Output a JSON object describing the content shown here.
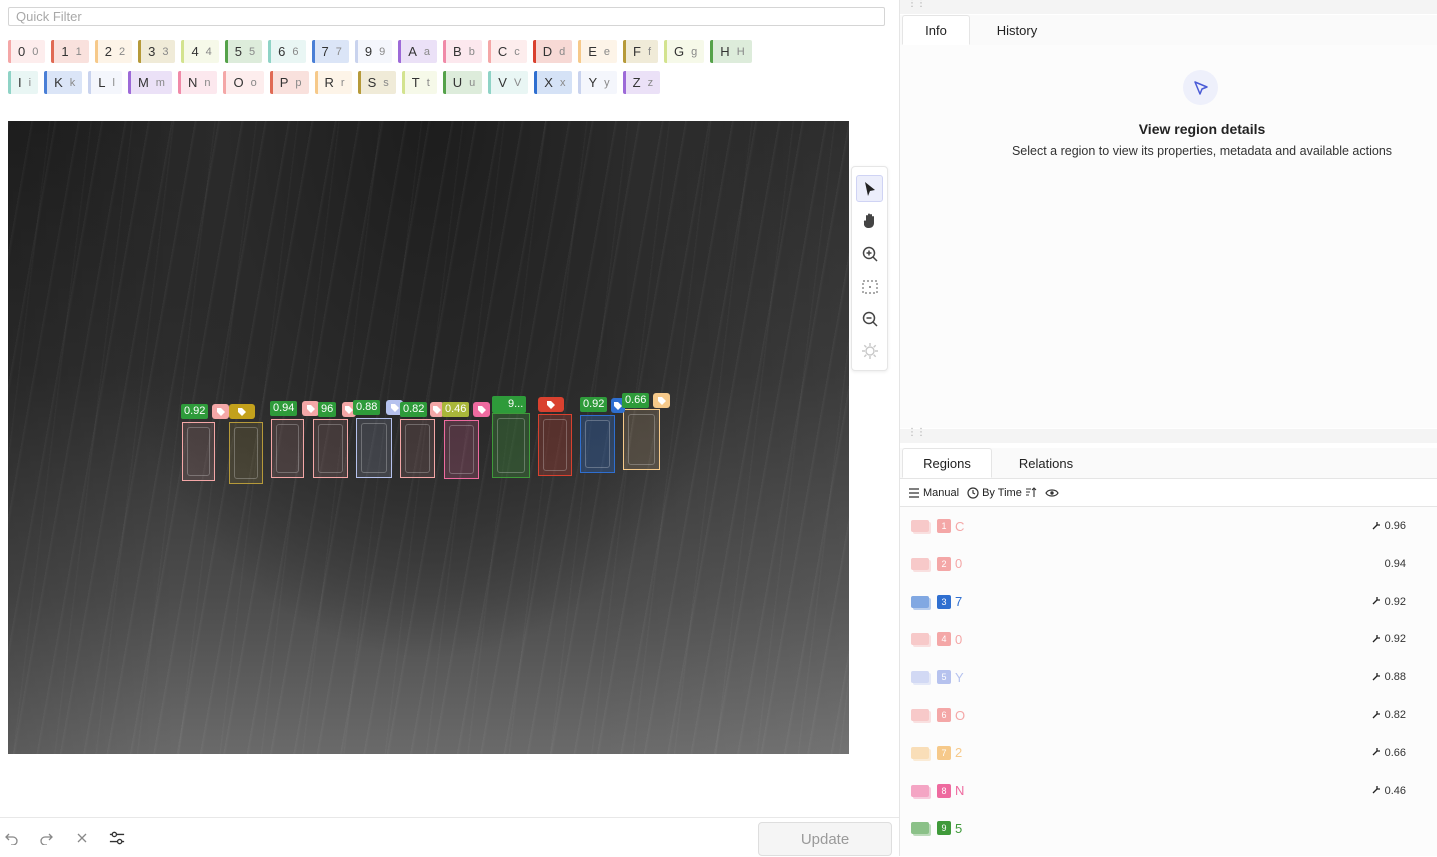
{
  "quick_filter": {
    "placeholder": "Quick Filter"
  },
  "labels_row1": [
    {
      "name": "0",
      "hotkey": "0",
      "color": "#f4a7a7"
    },
    {
      "name": "1",
      "hotkey": "1",
      "color": "#e06a54"
    },
    {
      "name": "2",
      "hotkey": "2",
      "color": "#f6c98a"
    },
    {
      "name": "3",
      "hotkey": "3",
      "color": "#b69a3a"
    },
    {
      "name": "4",
      "hotkey": "4",
      "color": "#d3e38f"
    },
    {
      "name": "5",
      "hotkey": "5",
      "color": "#55a24a"
    },
    {
      "name": "6",
      "hotkey": "6",
      "color": "#8fd3c6"
    },
    {
      "name": "7",
      "hotkey": "7",
      "color": "#4a7fd6"
    },
    {
      "name": "9",
      "hotkey": "9",
      "color": "#c9d3ee"
    },
    {
      "name": "A",
      "hotkey": "a",
      "color": "#9d6ad8"
    },
    {
      "name": "B",
      "hotkey": "b",
      "color": "#f08aa8"
    },
    {
      "name": "C",
      "hotkey": "c",
      "color": "#f4a7a7"
    },
    {
      "name": "D",
      "hotkey": "d",
      "color": "#d9412f"
    },
    {
      "name": "E",
      "hotkey": "e",
      "color": "#f6c98a"
    },
    {
      "name": "F",
      "hotkey": "f",
      "color": "#b69a3a"
    },
    {
      "name": "G",
      "hotkey": "g",
      "color": "#d3e38f"
    },
    {
      "name": "H",
      "hotkey": "H",
      "color": "#55a24a"
    }
  ],
  "labels_row2": [
    {
      "name": "I",
      "hotkey": "i",
      "color": "#8fd3c6"
    },
    {
      "name": "K",
      "hotkey": "k",
      "color": "#4a7fd6"
    },
    {
      "name": "L",
      "hotkey": "l",
      "color": "#c9d3ee"
    },
    {
      "name": "M",
      "hotkey": "m",
      "color": "#9d6ad8"
    },
    {
      "name": "N",
      "hotkey": "n",
      "color": "#f08aa8"
    },
    {
      "name": "O",
      "hotkey": "o",
      "color": "#f4a7a7"
    },
    {
      "name": "P",
      "hotkey": "p",
      "color": "#e06a54"
    },
    {
      "name": "R",
      "hotkey": "r",
      "color": "#f6c98a"
    },
    {
      "name": "S",
      "hotkey": "s",
      "color": "#b69a3a"
    },
    {
      "name": "T",
      "hotkey": "t",
      "color": "#d3e38f"
    },
    {
      "name": "U",
      "hotkey": "u",
      "color": "#55a24a"
    },
    {
      "name": "V",
      "hotkey": "V",
      "color": "#8fd3c6"
    },
    {
      "name": "X",
      "hotkey": "x",
      "color": "#2f6fd0"
    },
    {
      "name": "Y",
      "hotkey": "y",
      "color": "#c9d3ee"
    },
    {
      "name": "Z",
      "hotkey": "z",
      "color": "#9d6ad8"
    }
  ],
  "canvas_labels": [
    {
      "text": "0.92",
      "color": "#2e9b3a"
    },
    {
      "text": "0.94",
      "color": "#2e9b3a"
    },
    {
      "text": "96",
      "color": "#2e9b3a"
    },
    {
      "text": "0.88",
      "color": "#2e9b3a"
    },
    {
      "text": "0.82",
      "color": "#2e9b3a"
    },
    {
      "text": "0.46",
      "color": "#a9b73a"
    },
    {
      "text": "9...",
      "color": "#2e9b3a"
    },
    {
      "text": "0.92",
      "color": "#2e9b3a"
    },
    {
      "text": "0.66",
      "color": "#2e9b3a"
    }
  ],
  "right_panel": {
    "tabs_top": [
      {
        "label": "Info"
      },
      {
        "label": "History"
      }
    ],
    "info_title": "View region details",
    "info_subtitle": "Select a region to view its properties, metadata and available actions",
    "tabs_bottom": [
      {
        "label": "Regions"
      },
      {
        "label": "Relations"
      }
    ],
    "toolbar": {
      "manual_label": "Manual",
      "sort_label": "By Time"
    },
    "regions": [
      {
        "num": "1",
        "text": "C",
        "score": "0.96",
        "color": "#f4a7a7",
        "auto": true
      },
      {
        "num": "2",
        "text": "0",
        "score": "0.94",
        "color": "#f4a7a7",
        "auto": false
      },
      {
        "num": "3",
        "text": "7",
        "score": "0.92",
        "color": "#2f6fd0",
        "auto": true
      },
      {
        "num": "4",
        "text": "0",
        "score": "0.92",
        "color": "#f4a7a7",
        "auto": true
      },
      {
        "num": "5",
        "text": "Y",
        "score": "0.88",
        "color": "#b6c2ee",
        "auto": true
      },
      {
        "num": "6",
        "text": "O",
        "score": "0.82",
        "color": "#f4a7a7",
        "auto": true
      },
      {
        "num": "7",
        "text": "2",
        "score": "0.66",
        "color": "#f6c98a",
        "auto": true
      },
      {
        "num": "8",
        "text": "N",
        "score": "0.46",
        "color": "#ee6a9f",
        "auto": true
      },
      {
        "num": "9",
        "text": "5",
        "score": "",
        "color": "#3f9a3a",
        "auto": false
      }
    ]
  },
  "bottom_bar": {
    "update_label": "Update"
  },
  "icons": [
    "undo-icon",
    "redo-icon",
    "close-icon",
    "settings-sliders-icon",
    "pointer-icon",
    "hand-icon",
    "zoom-in-icon",
    "fit-icon",
    "zoom-out-icon",
    "brightness-icon",
    "tag-icon",
    "eye-icon",
    "clock-icon",
    "menu-icon",
    "sort-icon",
    "drag-handle-icon"
  ]
}
